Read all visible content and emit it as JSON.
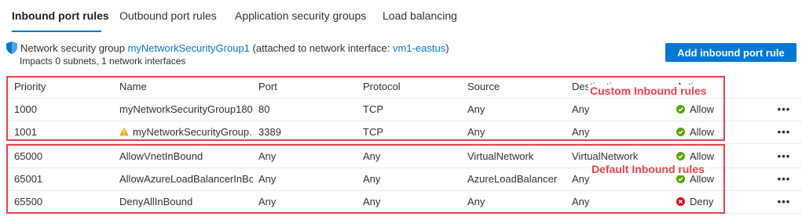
{
  "tabs": [
    {
      "label": "Inbound port rules",
      "active": true
    },
    {
      "label": "Outbound port rules",
      "active": false
    },
    {
      "label": "Application security groups",
      "active": false
    },
    {
      "label": "Load balancing",
      "active": false
    }
  ],
  "nsg": {
    "prefix": "Network security group",
    "group_name": "myNetworkSecurityGroup1",
    "attached_text": "(attached to network interface:",
    "nic_name": "vm1-eastus",
    "close_paren": ")",
    "impacts": "Impacts 0 subnets, 1 network interfaces"
  },
  "add_button_label": "Add inbound port rule",
  "columns": {
    "priority": "Priority",
    "name": "Name",
    "port": "Port",
    "protocol": "Protocol",
    "source": "Source",
    "destination": "Destination",
    "action": "Action"
  },
  "rows": [
    {
      "priority": "1000",
      "name": "myNetworkSecurityGroup180",
      "warning": false,
      "port": "80",
      "protocol": "TCP",
      "source": "Any",
      "destination": "Any",
      "action": "Allow",
      "more": "•••"
    },
    {
      "priority": "1001",
      "name": "myNetworkSecurityGroup...",
      "warning": true,
      "port": "3389",
      "protocol": "TCP",
      "source": "Any",
      "destination": "Any",
      "action": "Allow",
      "more": "•••"
    },
    {
      "priority": "65000",
      "name": "AllowVnetInBound",
      "warning": false,
      "port": "Any",
      "protocol": "Any",
      "source": "VirtualNetwork",
      "destination": "VirtualNetwork",
      "action": "Allow",
      "more": "•••"
    },
    {
      "priority": "65001",
      "name": "AllowAzureLoadBalancerInBo...",
      "warning": false,
      "port": "Any",
      "protocol": "Any",
      "source": "AzureLoadBalancer",
      "destination": "Any",
      "action": "Allow",
      "more": "•••"
    },
    {
      "priority": "65500",
      "name": "DenyAllInBound",
      "warning": false,
      "port": "Any",
      "protocol": "Any",
      "source": "Any",
      "destination": "Any",
      "action": "Deny",
      "more": "•••"
    }
  ],
  "annotations": {
    "custom": "Custom Inbound rules",
    "default": "Default Inbound rules"
  },
  "colors": {
    "accent": "#0078d4",
    "allow": "#57a300",
    "deny": "#e00b1c",
    "warning": "#f7a711",
    "annotation": "#e8434b"
  }
}
